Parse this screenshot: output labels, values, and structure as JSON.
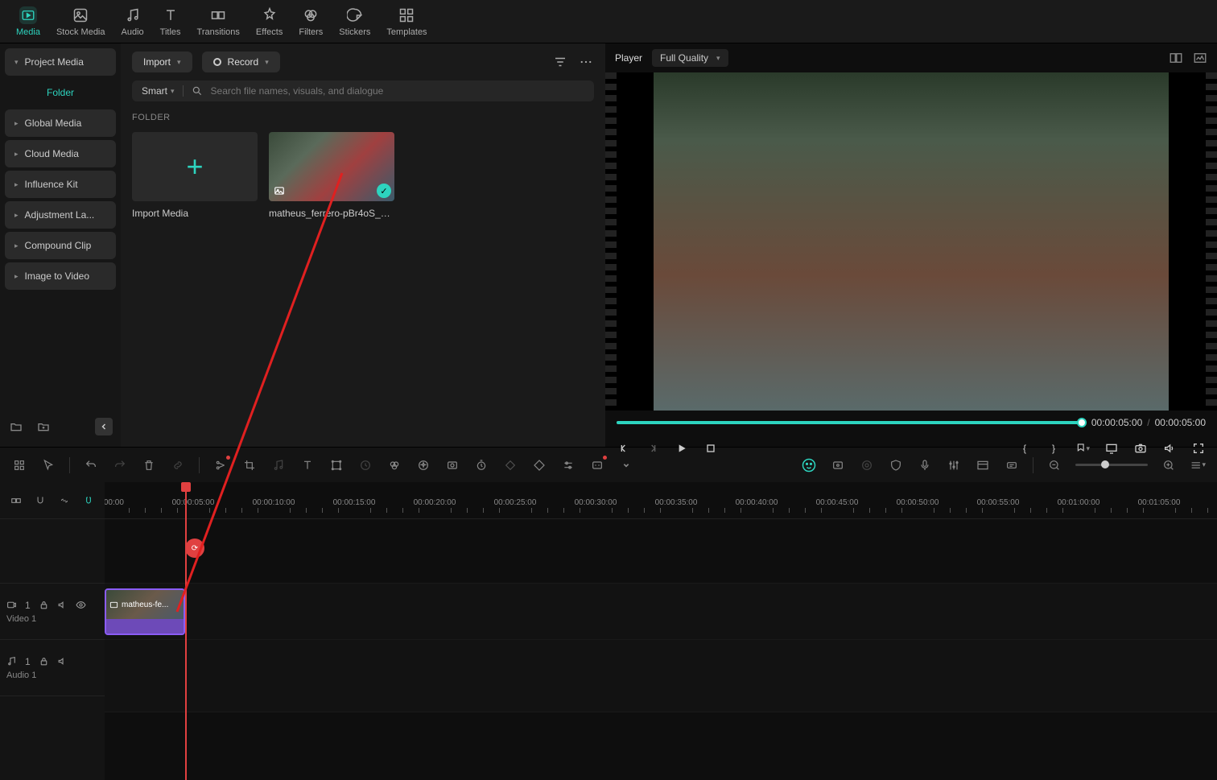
{
  "topTabs": [
    {
      "id": "media",
      "label": "Media",
      "active": true
    },
    {
      "id": "stock",
      "label": "Stock Media"
    },
    {
      "id": "audio",
      "label": "Audio"
    },
    {
      "id": "titles",
      "label": "Titles"
    },
    {
      "id": "transitions",
      "label": "Transitions"
    },
    {
      "id": "effects",
      "label": "Effects"
    },
    {
      "id": "filters",
      "label": "Filters"
    },
    {
      "id": "stickers",
      "label": "Stickers"
    },
    {
      "id": "templates",
      "label": "Templates"
    }
  ],
  "sidebar": {
    "project": "Project Media",
    "folder": "Folder",
    "items": [
      "Global Media",
      "Cloud Media",
      "Influence Kit",
      "Adjustment La...",
      "Compound Clip",
      "Image to Video"
    ]
  },
  "mediaToolbar": {
    "import": "Import",
    "record": "Record",
    "smart": "Smart",
    "searchPlaceholder": "Search file names, visuals, and dialogue"
  },
  "folderLabel": "FOLDER",
  "mediaItems": {
    "import": "Import Media",
    "file1": "matheus_ferrero-pBr4oS_a2..."
  },
  "player": {
    "label": "Player",
    "quality": "Full Quality",
    "current": "00:00:05:00",
    "total": "00:00:05:00",
    "sep": "/"
  },
  "ruler": [
    ":00:00",
    "00:00:05:00",
    "00:00:10:00",
    "00:00:15:00",
    "00:00:20:00",
    "00:00:25:00",
    "00:00:30:00",
    "00:00:35:00",
    "00:00:40:00",
    "00:00:45:00",
    "00:00:50:00",
    "00:00:55:00",
    "00:01:00:00",
    "00:01:05:00"
  ],
  "tracks": {
    "video": {
      "num": "1",
      "label": "Video 1"
    },
    "audio": {
      "num": "1",
      "label": "Audio 1"
    }
  },
  "clip": {
    "name": "matheus-fe..."
  }
}
